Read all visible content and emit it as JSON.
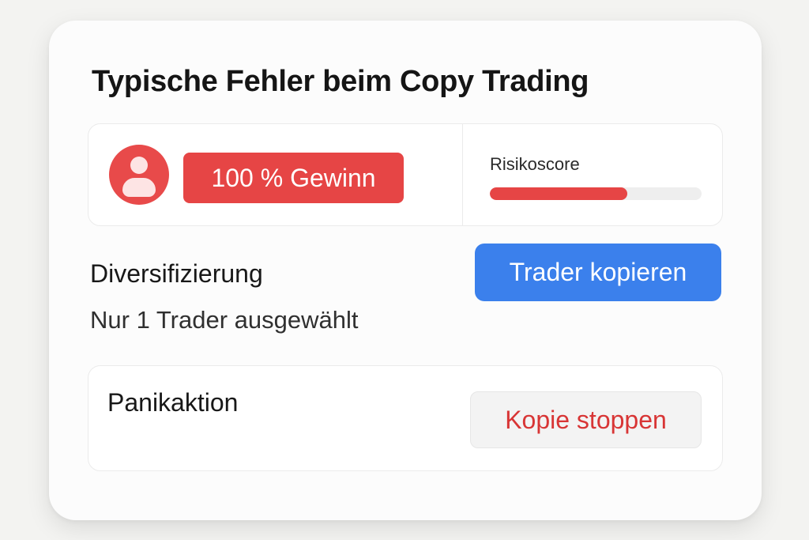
{
  "card": {
    "title": "Typische Fehler beim Copy Trading"
  },
  "profile": {
    "avatar_icon": "user-avatar-icon",
    "profit_badge": "100 % Gewinn"
  },
  "risk": {
    "label": "Risikoscore",
    "level_fraction": 0.65,
    "fill_color": "#e64545"
  },
  "diversification": {
    "label": "Diversifizierung",
    "status": "Nur 1 Trader ausgewählt"
  },
  "actions": {
    "copy_label": "Trader kopieren",
    "stop_label": "Kopie stoppen"
  },
  "panic": {
    "label": "Panikaktion"
  },
  "colors": {
    "accent_red": "#e64545",
    "accent_blue": "#3b80ec"
  }
}
